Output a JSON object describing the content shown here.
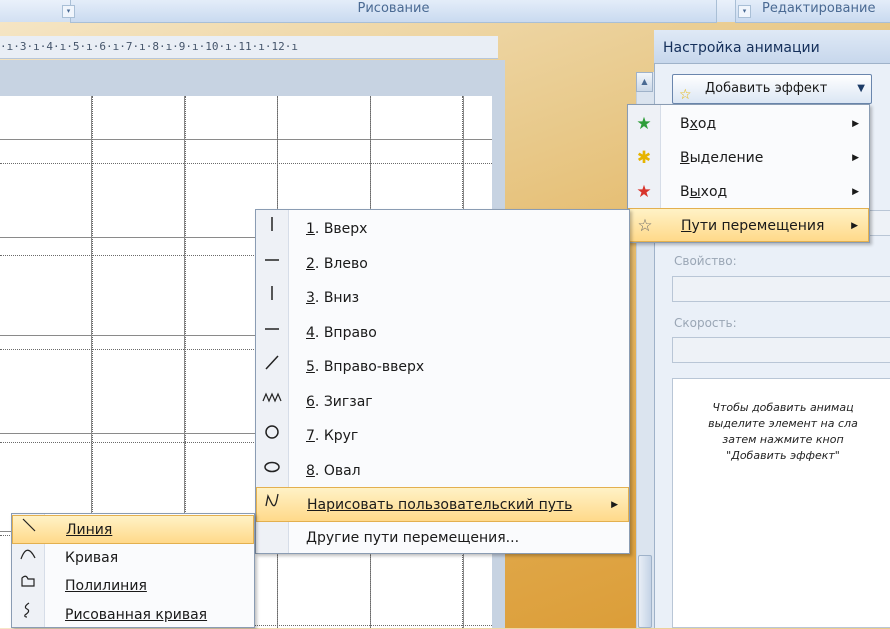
{
  "ribbon": {
    "group_drawing": "Рисование",
    "group_editing": "Редактирование"
  },
  "ruler": {
    "text": "·ı·3·ı·4·ı·5·ı·6·ı·7·ı·8·ı·9·ı·10·ı·11·ı·12·ı"
  },
  "pane": {
    "title": "Настройка анимации",
    "add_effect_label": "Добавить эффект",
    "property_label": "Свойство:",
    "speed_label": "Скорость:",
    "info_text": "Чтобы добавить анимац\nвыделите элемент на сла\nзатем нажмите кноп\n\"Добавить эффект\""
  },
  "effect_menu": {
    "items": [
      {
        "label": "Вход",
        "accel": "х",
        "icon": "entrance-star-icon",
        "color": "#2e9e3a"
      },
      {
        "label": "Выделение",
        "accel": "В",
        "icon": "emphasis-star-icon",
        "color": "#e6b400"
      },
      {
        "label": "Выход",
        "accel": "ы",
        "icon": "exit-star-icon",
        "color": "#d8342c"
      },
      {
        "label": "Пути перемещения",
        "accel": "П",
        "icon": "motion-path-star-icon",
        "color": "#7a7a7a"
      }
    ]
  },
  "paths_menu": {
    "items": [
      {
        "num": "1",
        "label": ". Вверх",
        "icon": "up-line-icon"
      },
      {
        "num": "2",
        "label": ". Влево",
        "icon": "left-line-icon"
      },
      {
        "num": "3",
        "label": ". Вниз",
        "icon": "down-line-icon"
      },
      {
        "num": "4",
        "label": ". Вправо",
        "icon": "right-line-icon"
      },
      {
        "num": "5",
        "label": ". Вправо-вверх",
        "icon": "diagonal-line-icon"
      },
      {
        "num": "6",
        "label": ". Зигзаг",
        "icon": "zigzag-icon"
      },
      {
        "num": "7",
        "label": ". Круг",
        "icon": "circle-icon"
      },
      {
        "num": "8",
        "label": ". Овал",
        "icon": "oval-icon"
      }
    ],
    "draw_custom": "Нарисовать пользовательский путь",
    "other_paths": "Другие пути перемещения..."
  },
  "custom_menu": {
    "items": [
      {
        "label": "Линия",
        "icon": "line-tool-icon"
      },
      {
        "label": "Кривая",
        "icon": "curve-tool-icon"
      },
      {
        "label": "Полилиния",
        "icon": "polyline-tool-icon"
      },
      {
        "label": "Рисованная кривая",
        "icon": "freeform-tool-icon"
      }
    ]
  },
  "colors": {
    "highlight": "#ffd98a",
    "pane_bg": "#eaf0f8",
    "background": "#e4b25a"
  }
}
